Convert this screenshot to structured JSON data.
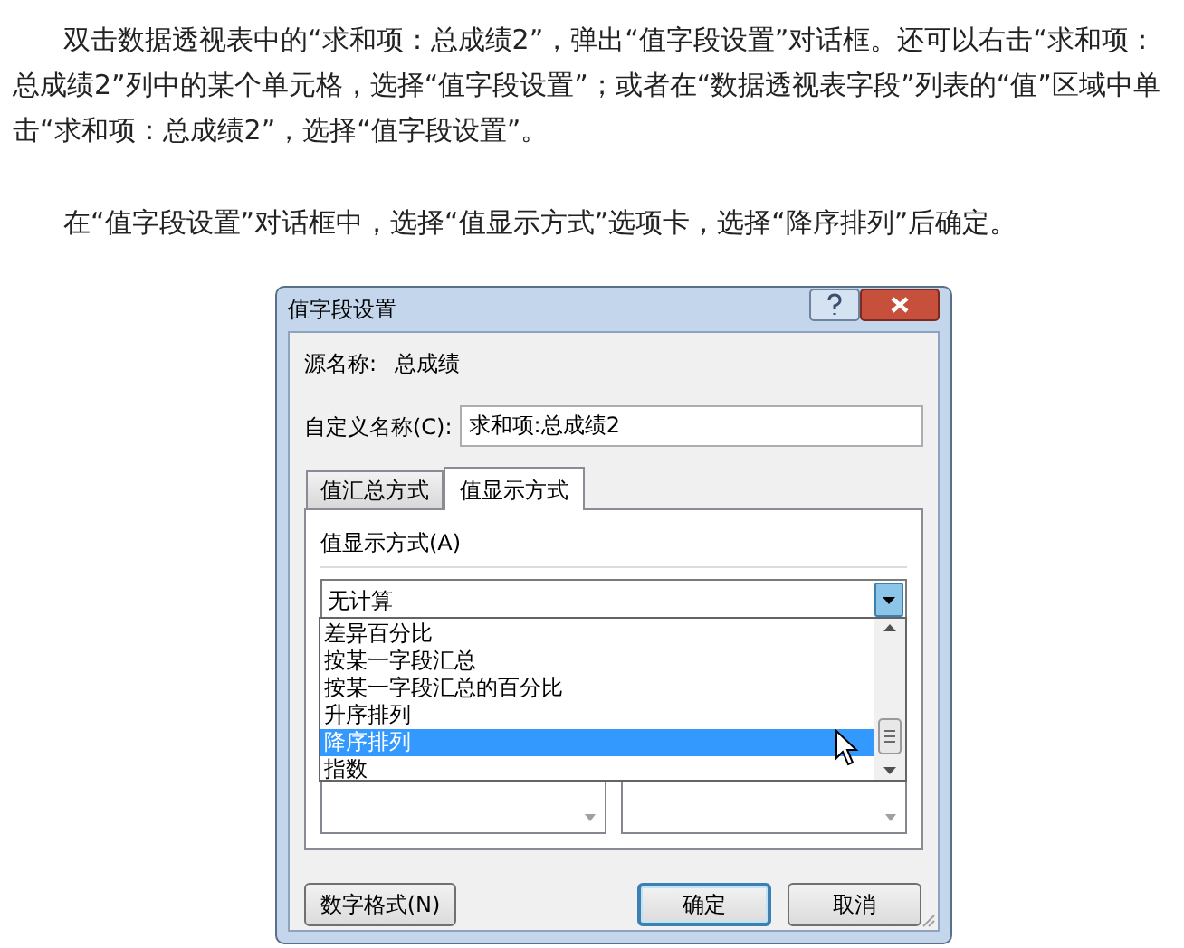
{
  "article": {
    "paragraphs": [
      "双击数据透视表中的“求和项：总成绩2”，弹出“值字段设置”对话框。还可以右击“求和项：总成绩2”列中的某个单元格，选择“值字段设置”；或者在“数据透视表字段”列表的“值”区域中单击“求和项：总成绩2”，选择“值字段设置”。",
      "在“值字段设置”对话框中，选择“值显示方式”选项卡，选择“降序排列”后确定。"
    ]
  },
  "dialog": {
    "title": "值字段设置",
    "source_label": "源名称:",
    "source_value": "总成绩",
    "custom_name_label": "自定义名称(C):",
    "custom_name_value": "求和项:总成绩2",
    "tabs": [
      {
        "label": "值汇总方式",
        "selected": false
      },
      {
        "label": "值显示方式",
        "selected": true
      }
    ],
    "show_values_label": "值显示方式(A)",
    "combo_value": "无计算",
    "dropdown_items": [
      {
        "label": "差异百分比",
        "selected": false
      },
      {
        "label": "按某一字段汇总",
        "selected": false
      },
      {
        "label": "按某一字段汇总的百分比",
        "selected": false
      },
      {
        "label": "升序排列",
        "selected": false
      },
      {
        "label": "降序排列",
        "selected": true
      },
      {
        "label": "指数",
        "selected": false
      }
    ],
    "buttons": [
      {
        "label": "数字格式(N)",
        "kind": "plain"
      },
      {
        "label": "确定",
        "kind": "default"
      },
      {
        "label": "取消",
        "kind": "plain"
      }
    ]
  }
}
